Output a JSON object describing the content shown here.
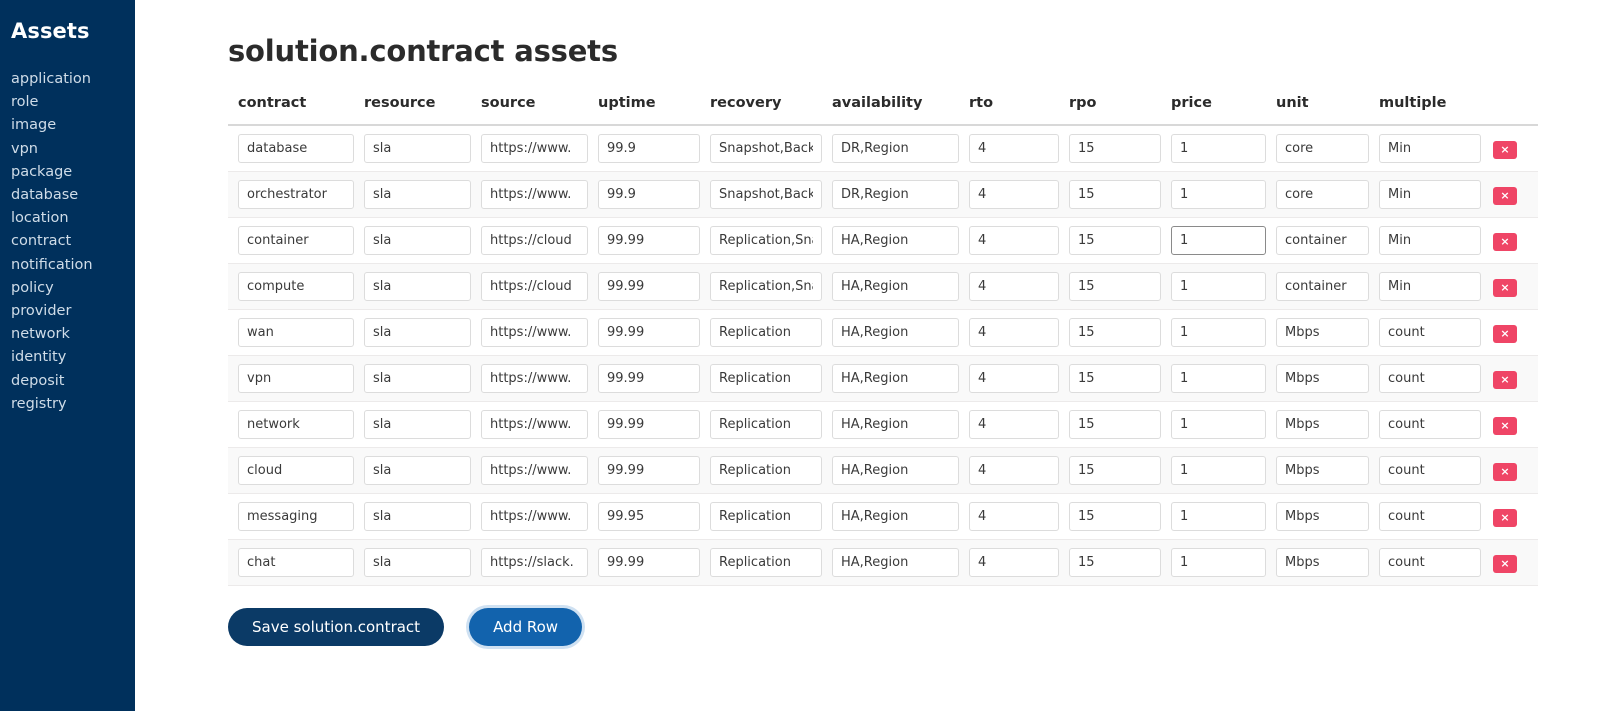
{
  "sidebar": {
    "title": "Assets",
    "items": [
      {
        "label": "application"
      },
      {
        "label": "role"
      },
      {
        "label": "image"
      },
      {
        "label": "vpn"
      },
      {
        "label": "package"
      },
      {
        "label": "database"
      },
      {
        "label": "location"
      },
      {
        "label": "contract"
      },
      {
        "label": "notification"
      },
      {
        "label": "policy"
      },
      {
        "label": "provider"
      },
      {
        "label": "network"
      },
      {
        "label": "identity"
      },
      {
        "label": "deposit"
      },
      {
        "label": "registry"
      }
    ]
  },
  "page": {
    "title": "solution.contract assets"
  },
  "table": {
    "columns": [
      {
        "key": "contract",
        "label": "contract"
      },
      {
        "key": "resource",
        "label": "resource"
      },
      {
        "key": "source",
        "label": "source"
      },
      {
        "key": "uptime",
        "label": "uptime"
      },
      {
        "key": "recovery",
        "label": "recovery"
      },
      {
        "key": "availability",
        "label": "availability"
      },
      {
        "key": "rto",
        "label": "rto"
      },
      {
        "key": "rpo",
        "label": "rpo"
      },
      {
        "key": "price",
        "label": "price"
      },
      {
        "key": "unit",
        "label": "unit"
      },
      {
        "key": "multiple",
        "label": "multiple"
      }
    ],
    "delete_label": "×",
    "rows": [
      {
        "contract": "database",
        "resource": "sla",
        "source": "https://www.",
        "uptime": "99.9",
        "recovery": "Snapshot,Back",
        "availability": "DR,Region",
        "rto": "4",
        "rpo": "15",
        "price": "1",
        "unit": "core",
        "multiple": "Min",
        "focused_field": ""
      },
      {
        "contract": "orchestrator",
        "resource": "sla",
        "source": "https://www.",
        "uptime": "99.9",
        "recovery": "Snapshot,Back",
        "availability": "DR,Region",
        "rto": "4",
        "rpo": "15",
        "price": "1",
        "unit": "core",
        "multiple": "Min",
        "focused_field": ""
      },
      {
        "contract": "container",
        "resource": "sla",
        "source": "https://cloud",
        "uptime": "99.99",
        "recovery": "Replication,Sna",
        "availability": "HA,Region",
        "rto": "4",
        "rpo": "15",
        "price": "1",
        "unit": "container",
        "multiple": "Min",
        "focused_field": "price"
      },
      {
        "contract": "compute",
        "resource": "sla",
        "source": "https://cloud",
        "uptime": "99.99",
        "recovery": "Replication,Sna",
        "availability": "HA,Region",
        "rto": "4",
        "rpo": "15",
        "price": "1",
        "unit": "container",
        "multiple": "Min",
        "focused_field": ""
      },
      {
        "contract": "wan",
        "resource": "sla",
        "source": "https://www.",
        "uptime": "99.99",
        "recovery": "Replication",
        "availability": "HA,Region",
        "rto": "4",
        "rpo": "15",
        "price": "1",
        "unit": "Mbps",
        "multiple": "count",
        "focused_field": ""
      },
      {
        "contract": "vpn",
        "resource": "sla",
        "source": "https://www.",
        "uptime": "99.99",
        "recovery": "Replication",
        "availability": "HA,Region",
        "rto": "4",
        "rpo": "15",
        "price": "1",
        "unit": "Mbps",
        "multiple": "count",
        "focused_field": ""
      },
      {
        "contract": "network",
        "resource": "sla",
        "source": "https://www.",
        "uptime": "99.99",
        "recovery": "Replication",
        "availability": "HA,Region",
        "rto": "4",
        "rpo": "15",
        "price": "1",
        "unit": "Mbps",
        "multiple": "count",
        "focused_field": ""
      },
      {
        "contract": "cloud",
        "resource": "sla",
        "source": "https://www.",
        "uptime": "99.99",
        "recovery": "Replication",
        "availability": "HA,Region",
        "rto": "4",
        "rpo": "15",
        "price": "1",
        "unit": "Mbps",
        "multiple": "count",
        "focused_field": ""
      },
      {
        "contract": "messaging",
        "resource": "sla",
        "source": "https://www.",
        "uptime": "99.95",
        "recovery": "Replication",
        "availability": "HA,Region",
        "rto": "4",
        "rpo": "15",
        "price": "1",
        "unit": "Mbps",
        "multiple": "count",
        "focused_field": ""
      },
      {
        "contract": "chat",
        "resource": "sla",
        "source": "https://slack.",
        "uptime": "99.99",
        "recovery": "Replication",
        "availability": "HA,Region",
        "rto": "4",
        "rpo": "15",
        "price": "1",
        "unit": "Mbps",
        "multiple": "count",
        "focused_field": ""
      }
    ]
  },
  "footer": {
    "save_label": "Save solution.contract",
    "add_row_label": "Add Row"
  },
  "colors": {
    "sidebar_bg": "#00305c",
    "sidebar_link": "#cfdce8",
    "delete_btn": "#ef4566",
    "save_btn": "#0b3a66",
    "add_btn": "#1263ad"
  }
}
